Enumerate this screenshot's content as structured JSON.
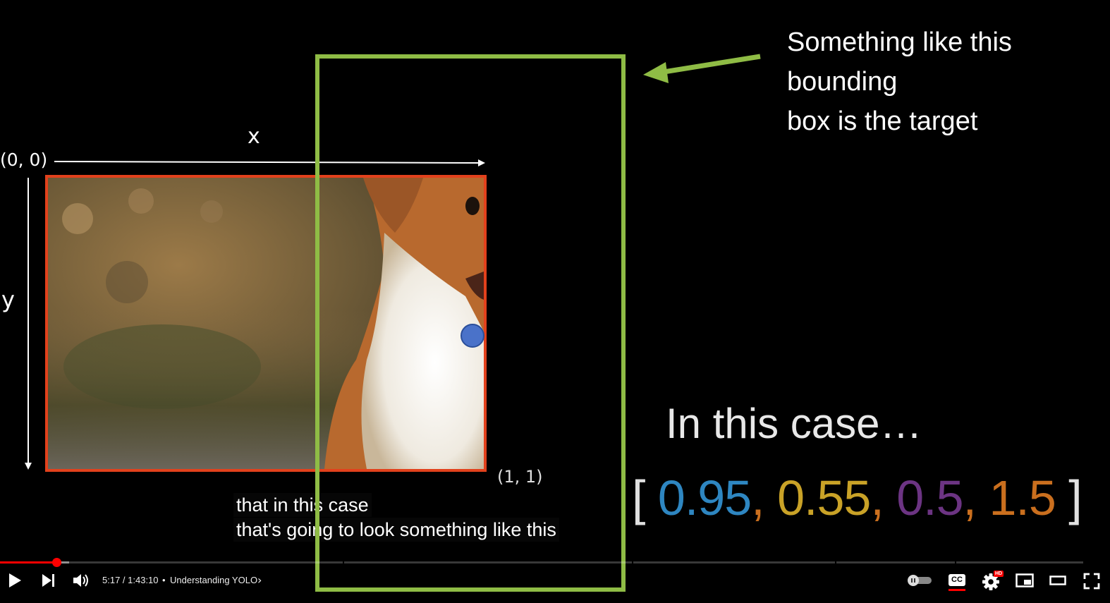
{
  "slide": {
    "origin_label": "(0, 0)",
    "x_label": "x",
    "y_label": "y",
    "end_label": "(1, 1)",
    "note_lines": [
      "Something like this",
      "bounding",
      "box is the target"
    ],
    "case_text": "In this case…",
    "vector": {
      "open": "[",
      "close": "]",
      "values": [
        {
          "text": "0.95",
          "color": "#2e86c1"
        },
        {
          "text": "0.55",
          "color": "#c9a227"
        },
        {
          "text": "0.5",
          "color": "#6c3483"
        },
        {
          "text": "1.5",
          "color": "#ca6f1e"
        }
      ],
      "separator": ",",
      "separator_color": "#ca6f1e"
    },
    "colors": {
      "red_box": "#e2411c",
      "green_box": "#8fbc45",
      "dot": "#4a72c9"
    }
  },
  "captions": {
    "line1": "that in this case",
    "line2": "that's going to look something like this"
  },
  "player": {
    "time": "5:17 / 1:43:10",
    "separator": "•",
    "chapter": "Understanding YOLO",
    "cc_label": "CC",
    "hd_badge": "HD",
    "progress_percent": 5.1,
    "accent": "#ff0000"
  }
}
